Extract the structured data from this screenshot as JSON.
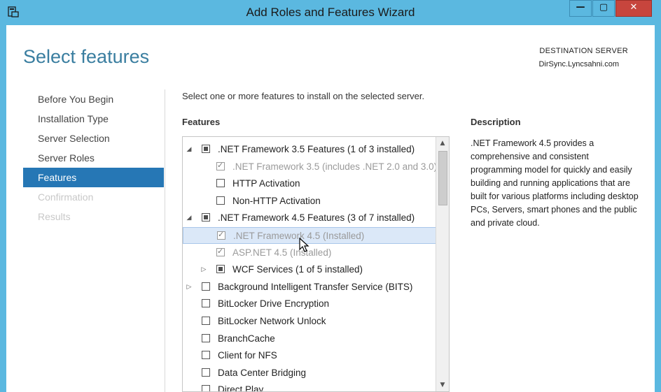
{
  "window": {
    "title": "Add Roles and Features Wizard",
    "min_label": "—",
    "max_label": "▢",
    "close_label": "✕"
  },
  "page": {
    "heading": "Select features",
    "destination_label": "DESTINATION SERVER",
    "destination_server": "DirSync.Lyncsahni.com"
  },
  "nav": {
    "items": [
      {
        "label": "Before You Begin",
        "state": "normal"
      },
      {
        "label": "Installation Type",
        "state": "normal"
      },
      {
        "label": "Server Selection",
        "state": "normal"
      },
      {
        "label": "Server Roles",
        "state": "normal"
      },
      {
        "label": "Features",
        "state": "active"
      },
      {
        "label": "Confirmation",
        "state": "disabled"
      },
      {
        "label": "Results",
        "state": "disabled"
      }
    ]
  },
  "content": {
    "instruction": "Select one or more features to install on the selected server.",
    "features_label": "Features",
    "description_label": "Description",
    "description_text": ".NET Framework 4.5 provides a comprehensive and consistent programming model for quickly and easily building and running applications that are built for various platforms including desktop PCs, Servers, smart phones and the public and private cloud."
  },
  "features": [
    {
      "label": ".NET Framework 3.5 Features (1 of 3 installed)",
      "level": 0,
      "expander": "expanded",
      "check": "partial"
    },
    {
      "label": ".NET Framework 3.5 (includes .NET 2.0 and 3.0)",
      "level": 1,
      "expander": "none",
      "check": "checked",
      "disabled": true
    },
    {
      "label": "HTTP Activation",
      "level": 1,
      "expander": "none",
      "check": "unchecked"
    },
    {
      "label": "Non-HTTP Activation",
      "level": 1,
      "expander": "none",
      "check": "unchecked"
    },
    {
      "label": ".NET Framework 4.5 Features (3 of 7 installed)",
      "level": 0,
      "expander": "expanded",
      "check": "partial"
    },
    {
      "label": ".NET Framework 4.5 (Installed)",
      "level": 1,
      "expander": "none",
      "check": "checked",
      "disabled": true,
      "selected": true
    },
    {
      "label": "ASP.NET 4.5 (Installed)",
      "level": 1,
      "expander": "none",
      "check": "checked",
      "disabled": true
    },
    {
      "label": "WCF Services (1 of 5 installed)",
      "level": 1,
      "expander": "collapsed",
      "check": "partial"
    },
    {
      "label": "Background Intelligent Transfer Service (BITS)",
      "level": 0,
      "expander": "collapsed",
      "check": "unchecked"
    },
    {
      "label": "BitLocker Drive Encryption",
      "level": 0,
      "expander": "none",
      "check": "unchecked"
    },
    {
      "label": "BitLocker Network Unlock",
      "level": 0,
      "expander": "none",
      "check": "unchecked"
    },
    {
      "label": "BranchCache",
      "level": 0,
      "expander": "none",
      "check": "unchecked"
    },
    {
      "label": "Client for NFS",
      "level": 0,
      "expander": "none",
      "check": "unchecked"
    },
    {
      "label": "Data Center Bridging",
      "level": 0,
      "expander": "none",
      "check": "unchecked"
    },
    {
      "label": "Direct Play",
      "level": 0,
      "expander": "none",
      "check": "unchecked"
    }
  ],
  "colors": {
    "frame": "#5bb8e0",
    "heading": "#3a7ea0",
    "nav_active": "#2677b5",
    "close_button": "#c7453d",
    "selection": "#dbe8f8"
  }
}
